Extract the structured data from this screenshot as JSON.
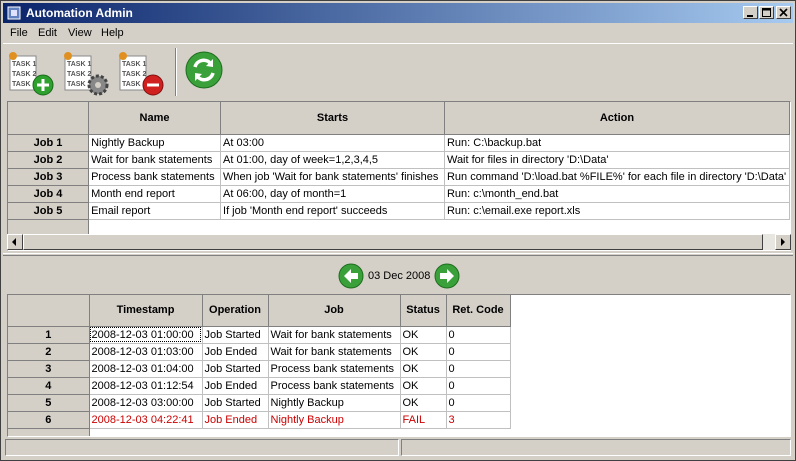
{
  "window": {
    "title": "Automation Admin"
  },
  "menu": [
    "File",
    "Edit",
    "View",
    "Help"
  ],
  "toolbar": {
    "add_task_icon": "task-add-icon",
    "edit_task_icon": "task-settings-icon",
    "delete_task_icon": "task-remove-icon",
    "refresh_icon": "refresh-icon",
    "task_lines": [
      "TASK 1",
      "TASK 2",
      "TASK 3"
    ]
  },
  "jobs": {
    "columns": [
      "Name",
      "Starts",
      "Action"
    ],
    "rows": [
      {
        "id": "Job 1",
        "name": "Nightly Backup",
        "starts": "At 03:00",
        "action": "Run: C:\\backup.bat"
      },
      {
        "id": "Job 2",
        "name": "Wait for bank statements",
        "starts": "At 01:00, day of week=1,2,3,4,5",
        "action": "Wait for files in directory 'D:\\Data'"
      },
      {
        "id": "Job 3",
        "name": "Process bank statements",
        "starts": "When job 'Wait for bank statements' finishes",
        "action": "Run command 'D:\\load.bat %FILE%' for each file in directory 'D:\\Data'"
      },
      {
        "id": "Job 4",
        "name": "Month end report",
        "starts": "At 06:00, day of month=1",
        "action": "Run: c:\\month_end.bat"
      },
      {
        "id": "Job 5",
        "name": "Email report",
        "starts": "If job 'Month end report' succeeds",
        "action": "Run: c:\\email.exe report.xls"
      }
    ]
  },
  "nav": {
    "date": "03 Dec 2008"
  },
  "log": {
    "columns": [
      "Timestamp",
      "Operation",
      "Job",
      "Status",
      "Ret. Code"
    ],
    "rows": [
      {
        "n": "1",
        "ts": "2008-12-03 01:00:00",
        "op": "Job Started",
        "job": "Wait for bank statements",
        "status": "OK",
        "code": "0",
        "fail": false
      },
      {
        "n": "2",
        "ts": "2008-12-03 01:03:00",
        "op": "Job Ended",
        "job": "Wait for bank statements",
        "status": "OK",
        "code": "0",
        "fail": false
      },
      {
        "n": "3",
        "ts": "2008-12-03 01:04:00",
        "op": "Job Started",
        "job": "Process bank statements",
        "status": "OK",
        "code": "0",
        "fail": false
      },
      {
        "n": "4",
        "ts": "2008-12-03 01:12:54",
        "op": "Job Ended",
        "job": "Process bank statements",
        "status": "OK",
        "code": "0",
        "fail": false
      },
      {
        "n": "5",
        "ts": "2008-12-03 03:00:00",
        "op": "Job Started",
        "job": "Nightly Backup",
        "status": "OK",
        "code": "0",
        "fail": false
      },
      {
        "n": "6",
        "ts": "2008-12-03 04:22:41",
        "op": "Job Ended",
        "job": "Nightly Backup",
        "status": "FAIL",
        "code": "3",
        "fail": true
      }
    ]
  },
  "colors": {
    "fail": "#cc0000",
    "title_start": "#0a246a",
    "title_end": "#a6caf0",
    "arrow_green": "#3aa13a"
  }
}
